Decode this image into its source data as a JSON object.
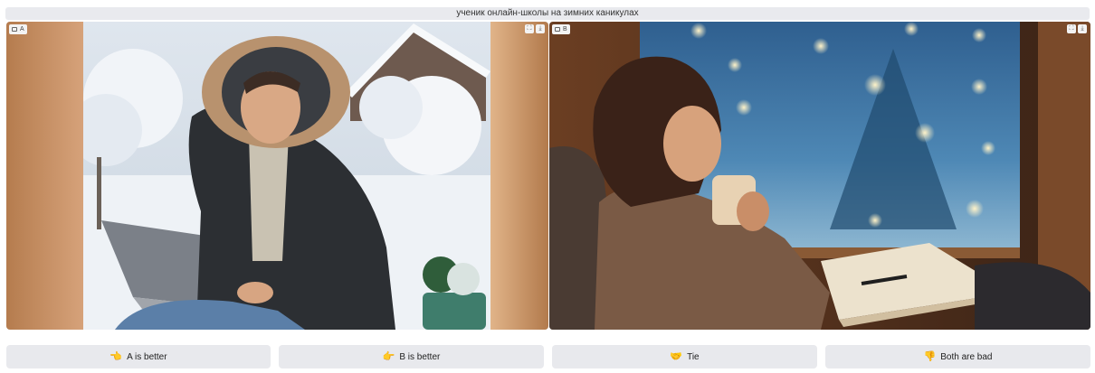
{
  "prompt": {
    "text": "ученик онлайн-школы на зимних каникулах"
  },
  "panels": {
    "a": {
      "label": "A",
      "image_subject": "young man in hooded winter jacket typing on laptop outside in snowy garden"
    },
    "b": {
      "label": "B",
      "image_subject": "young woman in knitted sweater holding mug by snowy window with bokeh lights and open book"
    }
  },
  "panel_controls": [
    "fullscreen-icon",
    "download-icon"
  ],
  "buttons": {
    "a_better": {
      "icon": "pointing-left-hand-icon",
      "label": "A is better"
    },
    "b_better": {
      "icon": "pointing-right-hand-icon",
      "label": "B is better"
    },
    "tie": {
      "icon": "handshake-icon",
      "label": "Tie"
    },
    "both_bad": {
      "icon": "thumbs-down-icon",
      "label": "Both are bad"
    }
  },
  "colors": {
    "button_bg": "#e8e9ed",
    "prompt_bg": "#e9eaee",
    "emoji_yellow": "#f5c430"
  }
}
